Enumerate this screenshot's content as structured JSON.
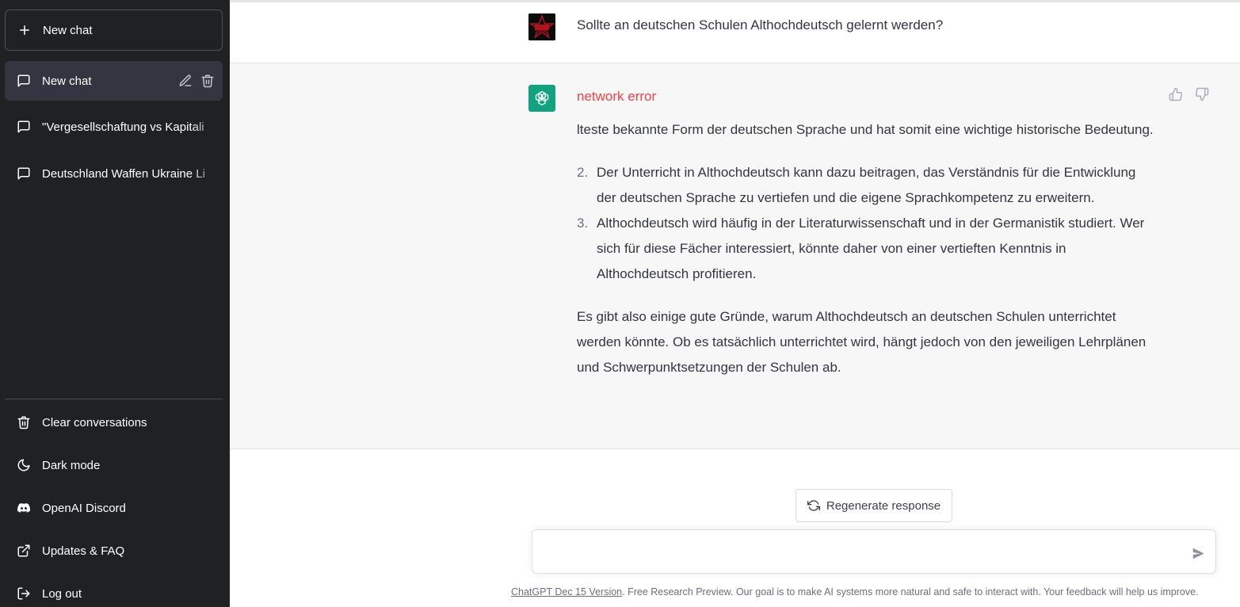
{
  "sidebar": {
    "new_chat_label": "New chat",
    "chats": [
      {
        "label": "New chat",
        "active": true
      },
      {
        "label": "\"Vergesellschaftung vs Kapitali",
        "active": false
      },
      {
        "label": "Deutschland Waffen Ukraine Li",
        "active": false
      }
    ],
    "bottom": {
      "clear": "Clear conversations",
      "dark_mode": "Dark mode",
      "discord": "OpenAI Discord",
      "updates": "Updates & FAQ",
      "logout": "Log out"
    }
  },
  "conversation": {
    "user_message": "Sollte an deutschen Schulen Althochdeutsch gelernt werden?",
    "error_text": "network error",
    "answer_intro": "lteste bekannte Form der deutschen Sprache und hat somit eine wichtige historische Bedeutung.",
    "answer_list": [
      {
        "num": "2.",
        "text": "Der Unterricht in Althochdeutsch kann dazu beitragen, das Verständnis für die Entwicklung der deutschen Sprache zu vertiefen und die eigene Sprachkompetenz zu erweitern."
      },
      {
        "num": "3.",
        "text": "Althochdeutsch wird häufig in der Literaturwissenschaft und in der Germanistik studiert. Wer sich für diese Fächer interessiert, könnte daher von einer vertieften Kenntnis in Althochdeutsch profitieren."
      }
    ],
    "answer_outro": "Es gibt also einige gute Gründe, warum Althochdeutsch an deutschen Schulen unterrichtet werden könnte. Ob es tatsächlich unterrichtet wird, hängt jedoch von den jeweiligen Lehrplänen und Schwerpunktsetzungen der Schulen ab."
  },
  "composer": {
    "regenerate_label": "Regenerate response",
    "input_value": "",
    "input_placeholder": ""
  },
  "footer": {
    "version_link": "ChatGPT Dec 15 Version",
    "text": ". Free Research Preview. Our goal is to make AI systems more natural and safe to interact with. Your feedback will help us improve."
  },
  "colors": {
    "sidebar_bg": "#202123",
    "active_chat_bg": "#343541",
    "bot_row_bg": "#f7f7f8",
    "error_red": "#ef4146",
    "openai_green": "#10a37f"
  }
}
